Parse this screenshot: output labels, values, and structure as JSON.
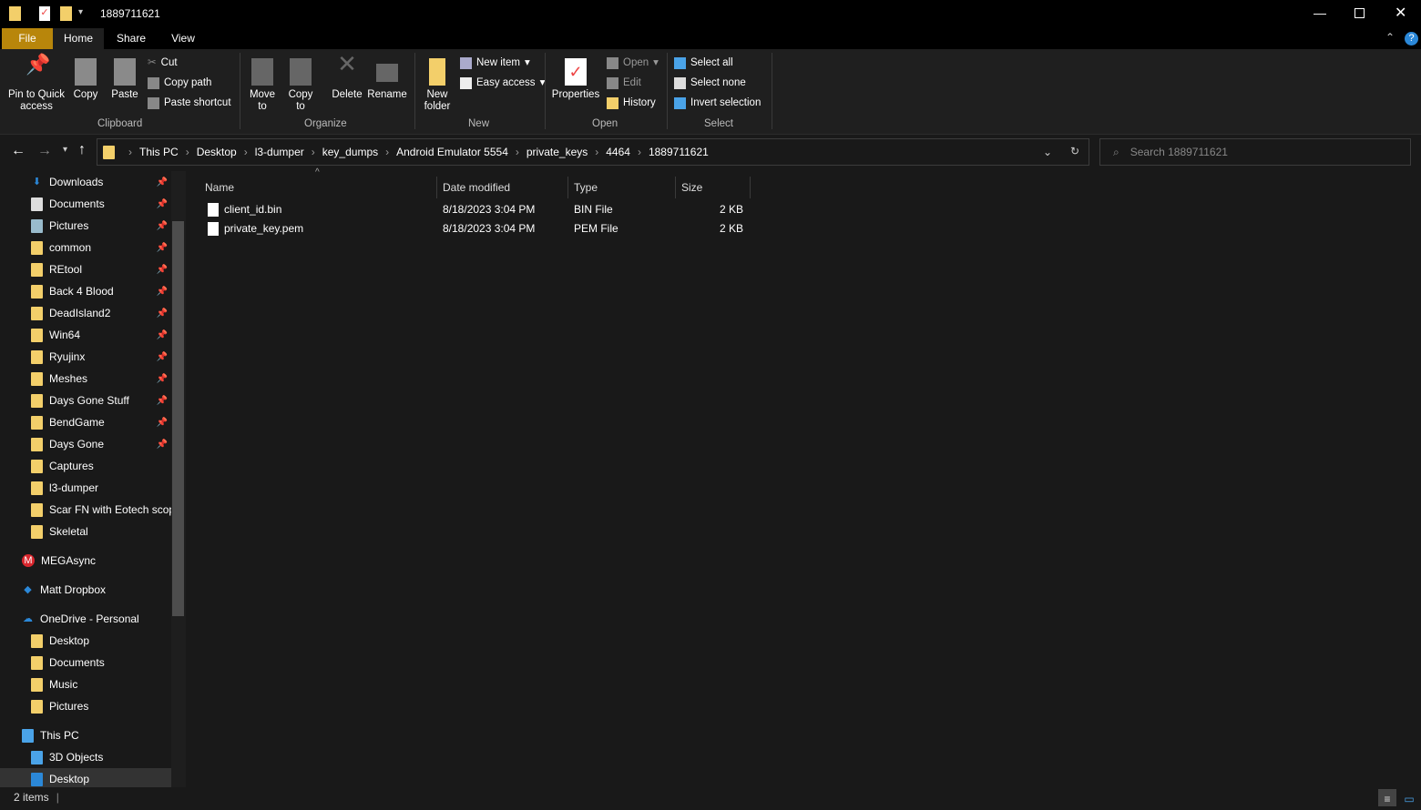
{
  "window": {
    "title": "1889711621"
  },
  "ribbon_tabs": [
    "File",
    "Home",
    "Share",
    "View"
  ],
  "ribbon": {
    "clipboard": {
      "pin": "Pin to Quick access",
      "copy": "Copy",
      "paste": "Paste",
      "cut": "Cut",
      "copy_path": "Copy path",
      "paste_shortcut": "Paste shortcut",
      "label": "Clipboard"
    },
    "organize": {
      "move_to": "Move to",
      "copy_to": "Copy to",
      "delete": "Delete",
      "rename": "Rename",
      "label": "Organize"
    },
    "new": {
      "new_folder": "New folder",
      "new_item": "New item",
      "easy_access": "Easy access",
      "label": "New"
    },
    "open": {
      "properties": "Properties",
      "open": "Open",
      "edit": "Edit",
      "history": "History",
      "label": "Open"
    },
    "select": {
      "select_all": "Select all",
      "select_none": "Select none",
      "invert": "Invert selection",
      "label": "Select"
    }
  },
  "address": {
    "crumbs": [
      "This PC",
      "Desktop",
      "l3-dumper",
      "key_dumps",
      "Android Emulator 5554",
      "private_keys",
      "4464",
      "1889711621"
    ],
    "search_placeholder": "Search 1889711621"
  },
  "sidebar": [
    {
      "label": "Downloads",
      "pin": true,
      "icon": "download"
    },
    {
      "label": "Documents",
      "pin": true,
      "icon": "documents"
    },
    {
      "label": "Pictures",
      "pin": true,
      "icon": "pictures"
    },
    {
      "label": "common",
      "pin": true
    },
    {
      "label": "REtool",
      "pin": true
    },
    {
      "label": "Back 4 Blood",
      "pin": true
    },
    {
      "label": "DeadIsland2",
      "pin": true
    },
    {
      "label": "Win64",
      "pin": true
    },
    {
      "label": "Ryujinx",
      "pin": true
    },
    {
      "label": "Meshes",
      "pin": true
    },
    {
      "label": "Days Gone Stuff",
      "pin": true
    },
    {
      "label": "BendGame",
      "pin": true
    },
    {
      "label": "Days Gone",
      "pin": true
    },
    {
      "label": "Captures"
    },
    {
      "label": "l3-dumper"
    },
    {
      "label": "Scar FN with Eotech scop"
    },
    {
      "label": "Skeletal"
    },
    {
      "label": "MEGAsync",
      "top": true,
      "icon": "mega"
    },
    {
      "label": "Matt Dropbox",
      "top": true,
      "icon": "dropbox"
    },
    {
      "label": "OneDrive - Personal",
      "top": true,
      "icon": "onedrive"
    },
    {
      "label": "Desktop"
    },
    {
      "label": "Documents"
    },
    {
      "label": "Music"
    },
    {
      "label": "Pictures"
    },
    {
      "label": "This PC",
      "top": true,
      "icon": "pc"
    },
    {
      "label": "3D Objects",
      "icon": "3d"
    },
    {
      "label": "Desktop",
      "icon": "desktop",
      "selected": true
    }
  ],
  "columns": [
    "Name",
    "Date modified",
    "Type",
    "Size"
  ],
  "files": [
    {
      "name": "client_id.bin",
      "date": "8/18/2023 3:04 PM",
      "type": "BIN File",
      "size": "2 KB"
    },
    {
      "name": "private_key.pem",
      "date": "8/18/2023 3:04 PM",
      "type": "PEM File",
      "size": "2 KB"
    }
  ],
  "status": {
    "count": "2 items"
  },
  "colors": {
    "file_tab": "#b8860b",
    "folder": "#f3cf6a",
    "accent": "#2b88d8"
  }
}
